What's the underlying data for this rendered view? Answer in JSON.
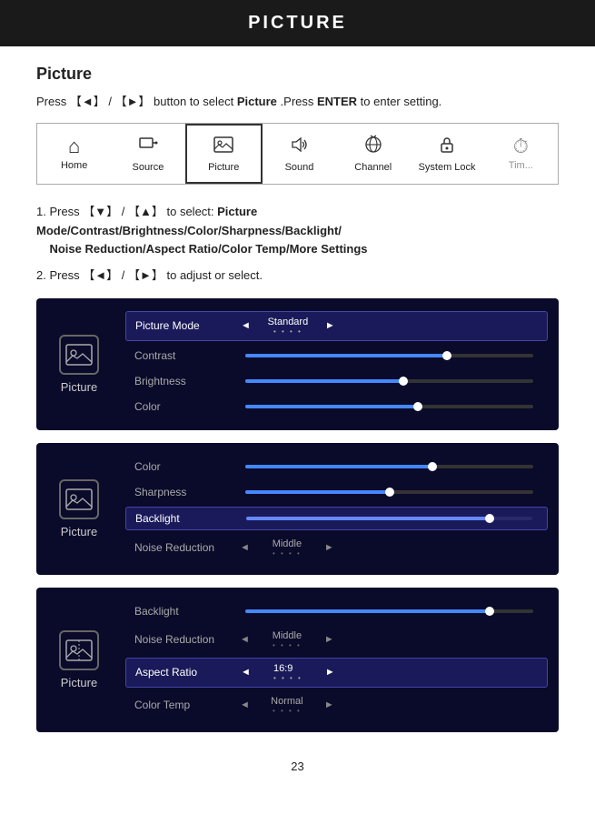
{
  "header": {
    "title": "PICTURE"
  },
  "section": {
    "title": "Picture",
    "intro": "Press 【◄】/ 【►】 button to select Picture .Press ENTER to enter setting."
  },
  "nav": {
    "items": [
      {
        "label": "Home",
        "icon": "⌂",
        "active": false
      },
      {
        "label": "Source",
        "icon": "⇒",
        "active": false
      },
      {
        "label": "Picture",
        "icon": "🖼",
        "active": true
      },
      {
        "label": "Sound",
        "icon": "🔊",
        "active": false
      },
      {
        "label": "Channel",
        "icon": "📡",
        "active": false
      },
      {
        "label": "System Lock",
        "icon": "🔒",
        "active": false
      },
      {
        "label": "Tim...",
        "icon": "⏱",
        "active": false
      }
    ]
  },
  "steps": [
    {
      "number": "1",
      "text": "Press 【▼】/ 【▲】 to select: Picture Mode/Contrast/Brightness/Color/Sharpness/Backlight/ Noise Reduction/Aspect Ratio/Color Temp/More Settings"
    },
    {
      "number": "2",
      "text": "Press 【◄】/ 【►】 to adjust or select."
    }
  ],
  "panels": [
    {
      "icon_label": "Picture",
      "rows": [
        {
          "label": "Picture Mode",
          "type": "value",
          "value": "Standard",
          "highlighted": true,
          "has_bar": false
        },
        {
          "label": "Contrast",
          "type": "bar",
          "fill_pct": 70,
          "thumb_pct": 70,
          "highlighted": false,
          "has_bar": true
        },
        {
          "label": "Brightness",
          "type": "bar",
          "fill_pct": 55,
          "thumb_pct": 55,
          "highlighted": false,
          "has_bar": true
        },
        {
          "label": "Color",
          "type": "bar",
          "fill_pct": 60,
          "thumb_pct": 60,
          "highlighted": false,
          "has_bar": true
        }
      ]
    },
    {
      "icon_label": "Picture",
      "rows": [
        {
          "label": "Color",
          "type": "bar",
          "fill_pct": 65,
          "thumb_pct": 65,
          "highlighted": false,
          "has_bar": true
        },
        {
          "label": "Sharpness",
          "type": "bar",
          "fill_pct": 50,
          "thumb_pct": 50,
          "highlighted": false,
          "has_bar": true
        },
        {
          "label": "Backlight",
          "type": "bar",
          "fill_pct": 85,
          "thumb_pct": 85,
          "highlighted": true,
          "has_bar": true
        },
        {
          "label": "Noise Reduction",
          "type": "value",
          "value": "Middle",
          "highlighted": false,
          "has_bar": false
        }
      ]
    },
    {
      "icon_label": "Picture",
      "rows": [
        {
          "label": "Backlight",
          "type": "bar",
          "fill_pct": 85,
          "thumb_pct": 85,
          "highlighted": false,
          "has_bar": true
        },
        {
          "label": "Noise Reduction",
          "type": "value",
          "value": "Middle",
          "highlighted": false,
          "has_bar": false
        },
        {
          "label": "Aspect Ratio",
          "type": "value",
          "value": "16:9",
          "highlighted": true,
          "has_bar": false
        },
        {
          "label": "Color Temp",
          "type": "value",
          "value": "Normal",
          "highlighted": false,
          "has_bar": false
        }
      ]
    }
  ],
  "page_number": "23"
}
